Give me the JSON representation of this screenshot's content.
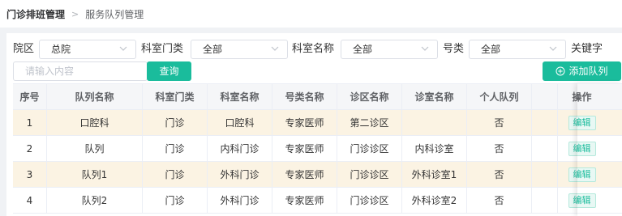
{
  "breadcrumb": {
    "root": "门诊排班管理",
    "separator": ">",
    "current": "服务队列管理"
  },
  "filters": {
    "campus": {
      "label": "院区",
      "value": "总院"
    },
    "dept_type": {
      "label": "科室门类",
      "value": "全部"
    },
    "dept_name": {
      "label": "科室名称",
      "value": "全部"
    },
    "reg_type": {
      "label": "号类",
      "value": "全部"
    },
    "keyword": {
      "label": "关键字",
      "placeholder": "请输入内容",
      "value": ""
    }
  },
  "buttons": {
    "query": "查询",
    "add": "添加队列"
  },
  "icons": {
    "chevron": "chevron-down-icon",
    "add": "plus-circle-icon"
  },
  "colors": {
    "accent": "#1abc9c",
    "row_highlight": "#fbf3e3",
    "header_bg": "#f5f6f8"
  },
  "table": {
    "columns": [
      "序号",
      "队列名称",
      "科室门类",
      "科室名称",
      "号类名称",
      "诊区名称",
      "诊室名称",
      "个人队列",
      "操作"
    ],
    "rows": [
      {
        "no": "1",
        "queue": "口腔科",
        "dept_type": "门诊",
        "dept": "口腔科",
        "reg_type": "专家医师",
        "area": "第二诊区",
        "room": "",
        "personal": "否",
        "action": "编辑"
      },
      {
        "no": "2",
        "queue": "队列",
        "dept_type": "门诊",
        "dept": "内科门诊",
        "reg_type": "专家医师",
        "area": "门诊诊区",
        "room": "内科诊室",
        "personal": "否",
        "action": "编辑"
      },
      {
        "no": "3",
        "queue": "队列1",
        "dept_type": "门诊",
        "dept": "外科门诊",
        "reg_type": "专家医师",
        "area": "门诊诊区",
        "room": "外科诊室1",
        "personal": "否",
        "action": "编辑"
      },
      {
        "no": "4",
        "queue": "队列2",
        "dept_type": "门诊",
        "dept": "外科门诊",
        "reg_type": "专家医师",
        "area": "门诊诊区",
        "room": "外科诊室2",
        "personal": "否",
        "action": "编辑"
      }
    ]
  }
}
